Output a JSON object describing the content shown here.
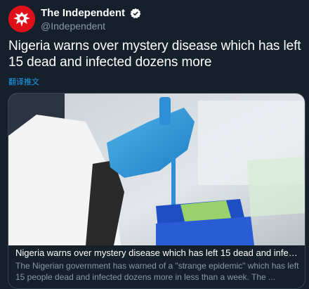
{
  "account": {
    "display_name": "The Independent",
    "handle": "@Independent",
    "avatar_icon": "independent-eagle-logo",
    "verified_icon": "verified-badge-icon",
    "brand_color": "#e0101a"
  },
  "tweet": {
    "text": "Nigeria warns over mystery disease which has left 15 dead and infected dozens more",
    "translate_label": "翻译推文"
  },
  "card": {
    "image_alt_icon": "lab-pipette-photo",
    "title": "Nigeria warns over mystery disease which has left 15 dead and infect...",
    "description": "The Nigerian government has warned of a \"strange epidemic\" which has left 15 people dead and infected dozens more in less than a week. The ..."
  },
  "colors": {
    "background": "#15202b",
    "link": "#1da1f2",
    "secondary_text": "#8899a6",
    "border": "#38444d"
  }
}
